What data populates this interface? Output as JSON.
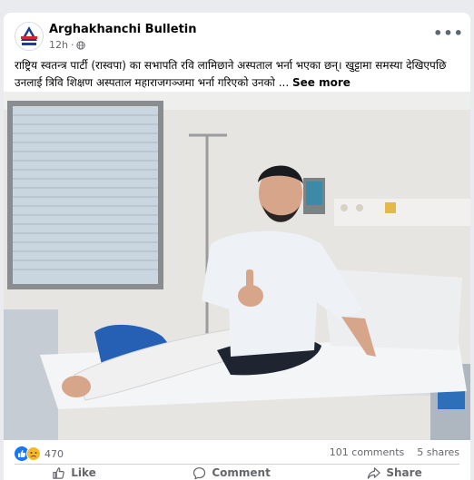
{
  "post": {
    "page_name": "Arghakhanchi Bulletin",
    "time": "12h",
    "privacy_icon": "globe-icon",
    "more_icon": "ellipsis-icon",
    "text": "राष्ट्रिय स्वतन्त्र पार्टी (रास्वपा) का सभापति रवि लामिछाने अस्पताल भर्ना भएका छन्। खुट्टामा समस्या देखिएपछि उनलाई त्रिवि शिक्षण अस्पताल महाराजगञ्जमा भर्ना गरिएको उनको ...",
    "see_more": "See more"
  },
  "engagement": {
    "reaction_icons": [
      "like-reaction-icon",
      "sad-reaction-icon"
    ],
    "reaction_count": "470",
    "comments": "101 comments",
    "shares": "5 shares"
  },
  "actions": {
    "like": "Like",
    "comment": "Comment",
    "share": "Share"
  },
  "colors": {
    "background": "#e9ebee",
    "card": "#ffffff",
    "secondary_text": "#65676b",
    "like_blue": "#1877f2",
    "sad_yellow": "#f7b928"
  }
}
